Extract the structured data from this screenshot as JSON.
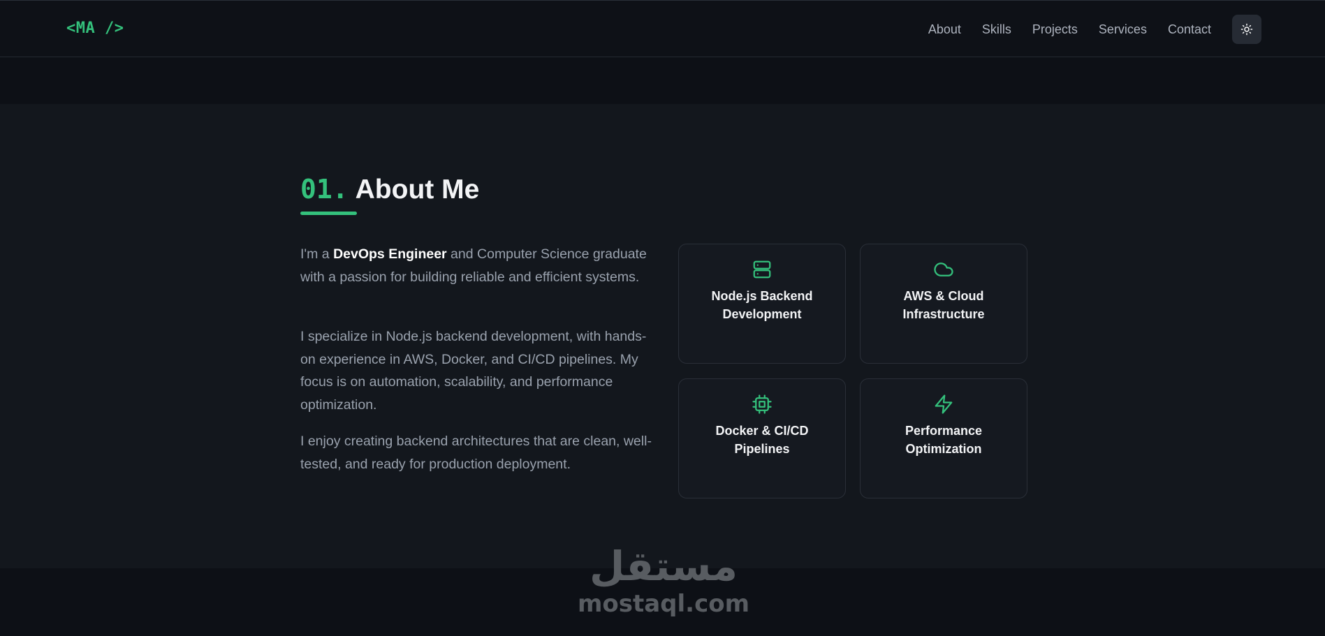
{
  "nav": {
    "logo": "<MA />",
    "links": [
      "About",
      "Skills",
      "Projects",
      "Services",
      "Contact"
    ],
    "theme_toggle_icon": "sun-icon"
  },
  "about": {
    "number": "01.",
    "title": "About Me",
    "paragraph1": {
      "prefix": "I'm a ",
      "highlight": "DevOps Engineer",
      "suffix": " and Computer Science graduate with a passion for building reliable and efficient systems."
    },
    "paragraph2": "I specialize in Node.js backend development, with hands-on experience in AWS, Docker, and CI/CD pipelines. My focus is on automation, scalability, and performance optimization.",
    "paragraph3": "I enjoy creating backend architectures that are clean, well-tested, and ready for production deployment.",
    "cards": [
      {
        "icon": "server-icon",
        "label": "Node.js Backend\nDevelopment"
      },
      {
        "icon": "cloud-icon",
        "label": "AWS & Cloud\nInfrastructure"
      },
      {
        "icon": "cpu-icon",
        "label": "Docker & CI/CD\nPipelines"
      },
      {
        "icon": "lightning-icon",
        "label": "Performance\nOptimization"
      }
    ]
  },
  "watermark": {
    "arabic": "مستقل",
    "latin": "mostaql.com"
  },
  "colors": {
    "accent": "#34c17c",
    "background": "#0d1016",
    "section_background": "#13171d",
    "card_background": "#151920",
    "text_muted": "#9aa2ae"
  }
}
